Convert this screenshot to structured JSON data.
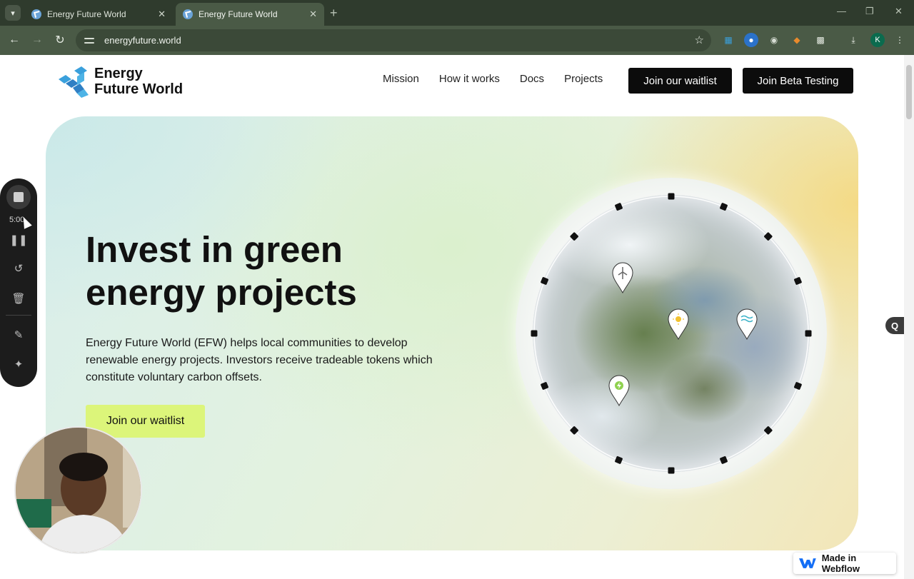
{
  "browser": {
    "tabs": [
      {
        "title": "Energy Future World",
        "active": false
      },
      {
        "title": "Energy Future World",
        "active": true
      }
    ],
    "url": "energyfuture.world",
    "profile_initial": "K"
  },
  "site": {
    "logo": {
      "line1": "Energy",
      "line2": "Future World"
    },
    "nav": [
      "Mission",
      "How it works",
      "Docs",
      "Projects"
    ],
    "cta_waitlist": "Join our waitlist",
    "cta_beta": "Join Beta Testing"
  },
  "hero": {
    "title_line1": "Invest in green",
    "title_line2": "energy projects",
    "description": "Energy Future World (EFW) helps local communities to develop renewable energy projects. Investors receive tradeable tokens which constitute voluntary carbon offsets.",
    "button": "Join our waitlist",
    "pins": [
      "wind-turbine-icon",
      "sun-icon",
      "water-wave-icon",
      "battery-charge-icon"
    ]
  },
  "recorder": {
    "time": "5:00"
  },
  "side_badge": "Q",
  "webflow_badge": "Made in Webflow",
  "colors": {
    "accent_green": "#dcf57a",
    "logo_blue": "#3aa0dc",
    "dark_button": "#0c0c0c"
  }
}
